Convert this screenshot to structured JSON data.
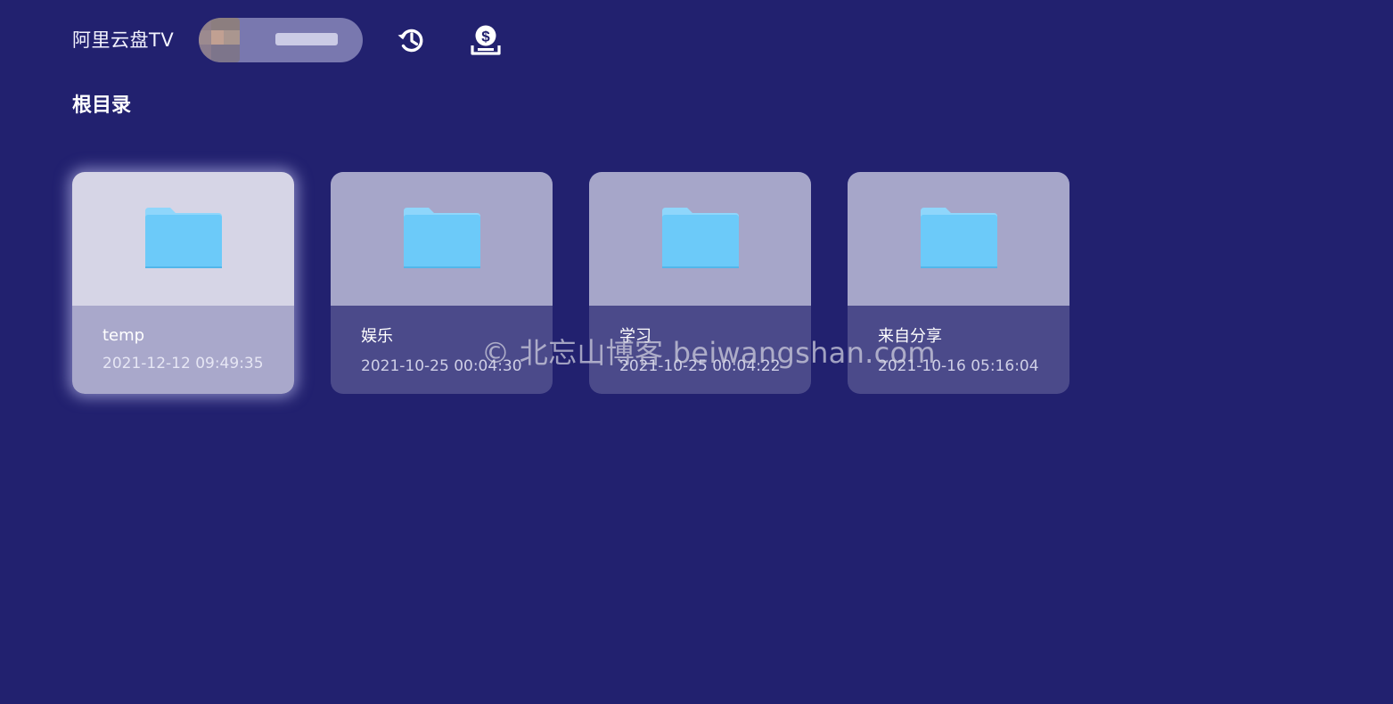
{
  "app": {
    "title": "阿里云盘TV"
  },
  "header": {
    "history_icon": "history-icon",
    "donate_icon": "donate-icon"
  },
  "section": {
    "title": "根目录"
  },
  "folders": [
    {
      "name": "temp",
      "date": "2021-12-12 09:49:35",
      "focused": true,
      "icon": "folder-icon"
    },
    {
      "name": "娱乐",
      "date": "2021-10-25 00:04:30",
      "focused": false,
      "icon": "folder-icon"
    },
    {
      "name": "学习",
      "date": "2021-10-25 00:04:22",
      "focused": false,
      "icon": "folder-icon"
    },
    {
      "name": "来自分享",
      "date": "2021-10-16 05:16:04",
      "focused": false,
      "icon": "folder-icon"
    }
  ],
  "watermark": {
    "text": "© 北忘山博客 beiwangshan.com"
  },
  "colors": {
    "background": "#22216f",
    "card_thumb": "#a6a6c9",
    "card_meta": "#4b4a8a",
    "folder": "#6ccaf9"
  }
}
